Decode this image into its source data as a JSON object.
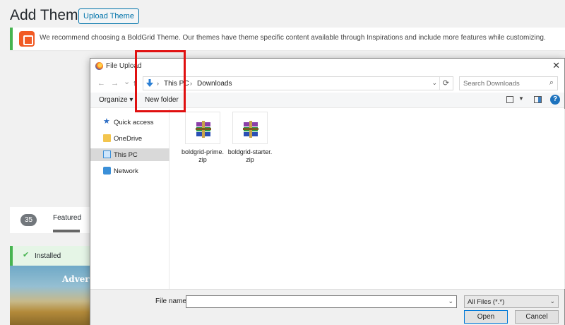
{
  "wp": {
    "page_title": "Add Themes",
    "upload_button": "Upload Theme",
    "notice_text": "We recommend choosing a BoldGrid Theme. Our themes have theme specific content available through Inspirations and include more features while customizing.",
    "theme_count": "35",
    "featured_tab": "Featured",
    "installed_label": "Installed",
    "theme_preview_title": "Adver",
    "colors": {
      "accent": "#0073aa",
      "success": "#46b450",
      "brand": "#f15a24"
    }
  },
  "dialog": {
    "title": "File Upload",
    "close_label": "✕",
    "nav": {
      "back": "←",
      "forward": "→",
      "recent": "⌄",
      "up": "↑"
    },
    "address": {
      "crumbs": [
        "This PC",
        "Downloads"
      ],
      "separator": "›"
    },
    "search_placeholder": "Search Downloads",
    "toolbar": {
      "organize": "Organize ▾",
      "new_folder": "New folder"
    },
    "nav_pane": [
      {
        "label": "Quick access",
        "icon": "star-icon"
      },
      {
        "label": "OneDrive",
        "icon": "folder-icon"
      },
      {
        "label": "This PC",
        "icon": "computer-icon",
        "selected": true
      },
      {
        "label": "Network",
        "icon": "network-icon"
      }
    ],
    "files": [
      {
        "name": "boldgrid-prime.zip",
        "icon": "winrar-archive-icon"
      },
      {
        "name": "boldgrid-starter.zip",
        "icon": "winrar-archive-icon",
        "highlighted": true
      }
    ],
    "footer": {
      "file_name_label": "File name:",
      "file_name_value": "",
      "file_type": "All Files (*.*)",
      "open_button": "Open",
      "cancel_button": "Cancel"
    },
    "highlight_color": "#e01010"
  }
}
